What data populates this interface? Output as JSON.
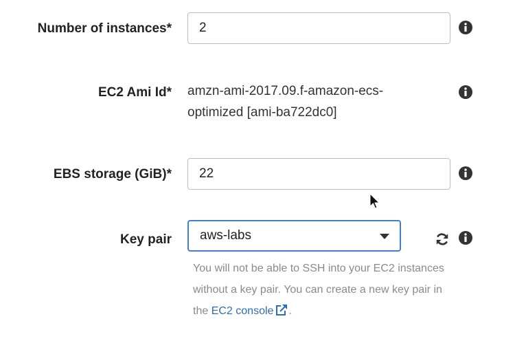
{
  "fields": {
    "instances": {
      "label": "Number of instances*",
      "value": "2"
    },
    "ami": {
      "label": "EC2 Ami Id*",
      "value": "amzn-ami-2017.09.f-amazon-ecs-optimized [ami-ba722dc0]"
    },
    "ebs": {
      "label": "EBS storage (GiB)*",
      "value": "22"
    },
    "keypair": {
      "label": "Key pair",
      "selected": "aws-labs",
      "help_text": "You will not be able to SSH into your EC2 instances without a key pair. You can create a new key pair in the",
      "link_text": "EC2 console",
      "help_end": "."
    }
  },
  "icons": {
    "info": "info-icon",
    "refresh": "refresh-icon",
    "external_link": "external-link-icon",
    "cursor": "mouse-cursor"
  },
  "colors": {
    "link": "#2a6ebb",
    "focus_border": "#3f7fd3",
    "help_text": "#8a8a8a"
  }
}
